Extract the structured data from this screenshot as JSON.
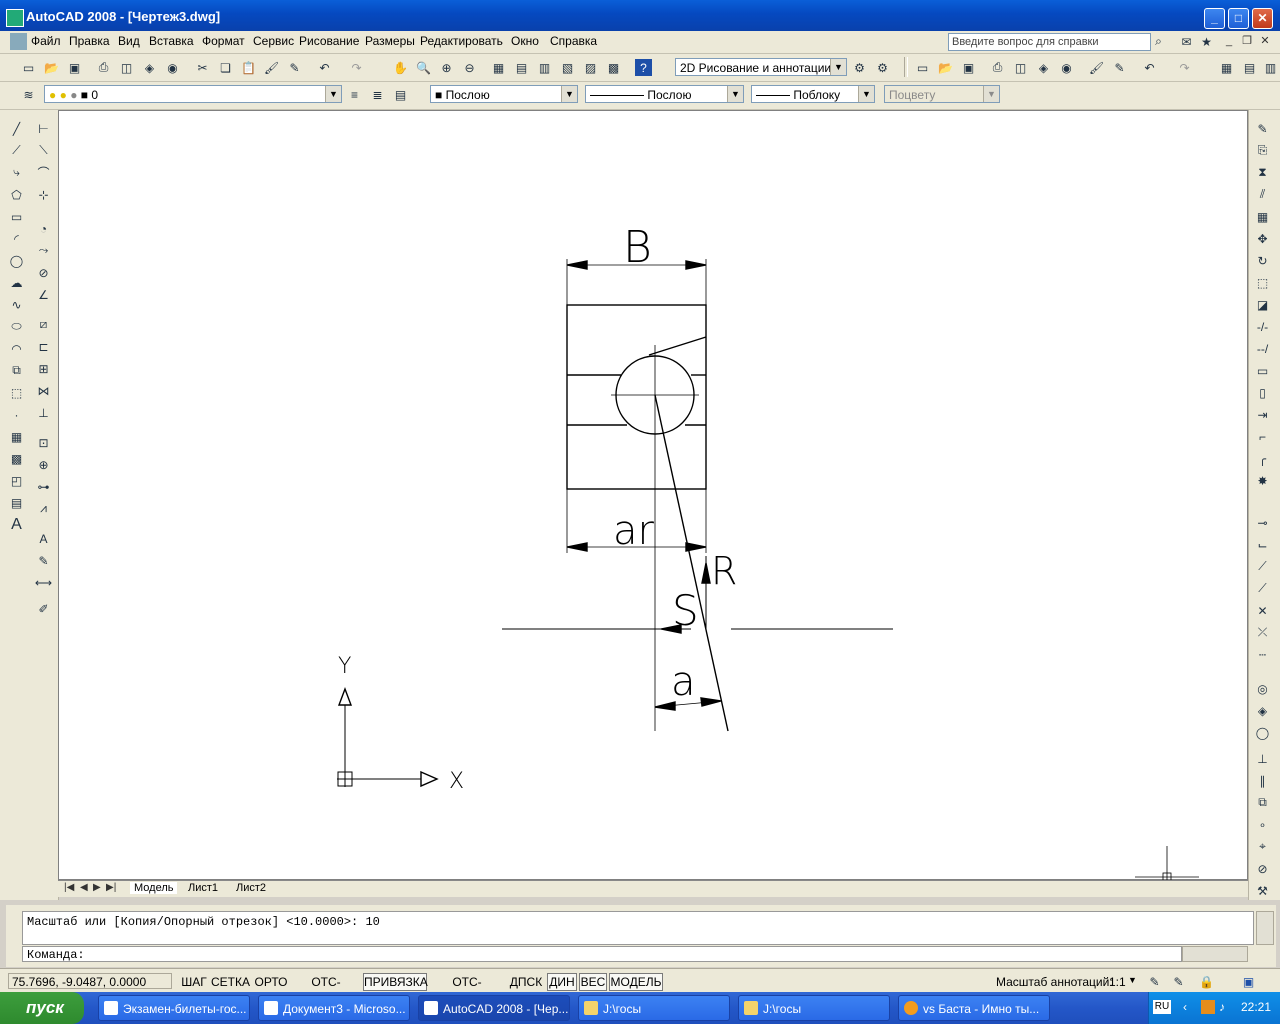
{
  "window": {
    "title": "AutoCAD 2008 - [Чертеж3.dwg]"
  },
  "menu": {
    "items": [
      "Файл",
      "Правка",
      "Вид",
      "Вставка",
      "Формат",
      "Сервис",
      "Рисование",
      "Размеры",
      "Редактировать",
      "Окно",
      "Справка"
    ],
    "help_placeholder": "Введите вопрос для справки"
  },
  "toolbar": {
    "workspace": "2D Рисование и аннотации"
  },
  "properties": {
    "layer": "0",
    "color": "Послою",
    "linetype": "Послою",
    "lineweight": "Поблоку",
    "plotstyle": "Поцвету"
  },
  "drawing": {
    "label_B": "B",
    "label_ar": "ar",
    "label_R": "R",
    "label_S": "S",
    "label_a": "a",
    "axis_y": "Y",
    "axis_x": "X"
  },
  "tabs": [
    "Модель",
    "Лист1",
    "Лист2"
  ],
  "command": {
    "history": "Масштаб или  [Копия/Опорный отрезок] <10.0000>: 10",
    "prompt": "Команда:"
  },
  "status": {
    "coords": "75.7696, -9.0487, 0.0000",
    "buttons": [
      "ШАГ",
      "СЕТКА",
      "ОРТО",
      "ОТС-ПОЛЯР",
      "ПРИВЯЗКА",
      "ОТС-ОБЪЕКТ",
      "ДПСК",
      "ДИН",
      "ВЕС",
      "МОДЕЛЬ"
    ],
    "on": [
      "ПРИВЯЗКА",
      "ДИН",
      "ВЕС",
      "МОДЕЛЬ"
    ],
    "annotation_label": "Масштаб аннотаций:",
    "annotation_scale": "1:1"
  },
  "taskbar": {
    "start": "пуск",
    "tasks": [
      "Экзамен-билеты-гос...",
      "Документ3 - Microso...",
      "AutoCAD 2008 - [Чер...",
      "J:\\госы",
      "J:\\госы",
      "vs Баста - Имно ты..."
    ],
    "active_index": 2,
    "lang": "RU",
    "clock": "22:21"
  }
}
